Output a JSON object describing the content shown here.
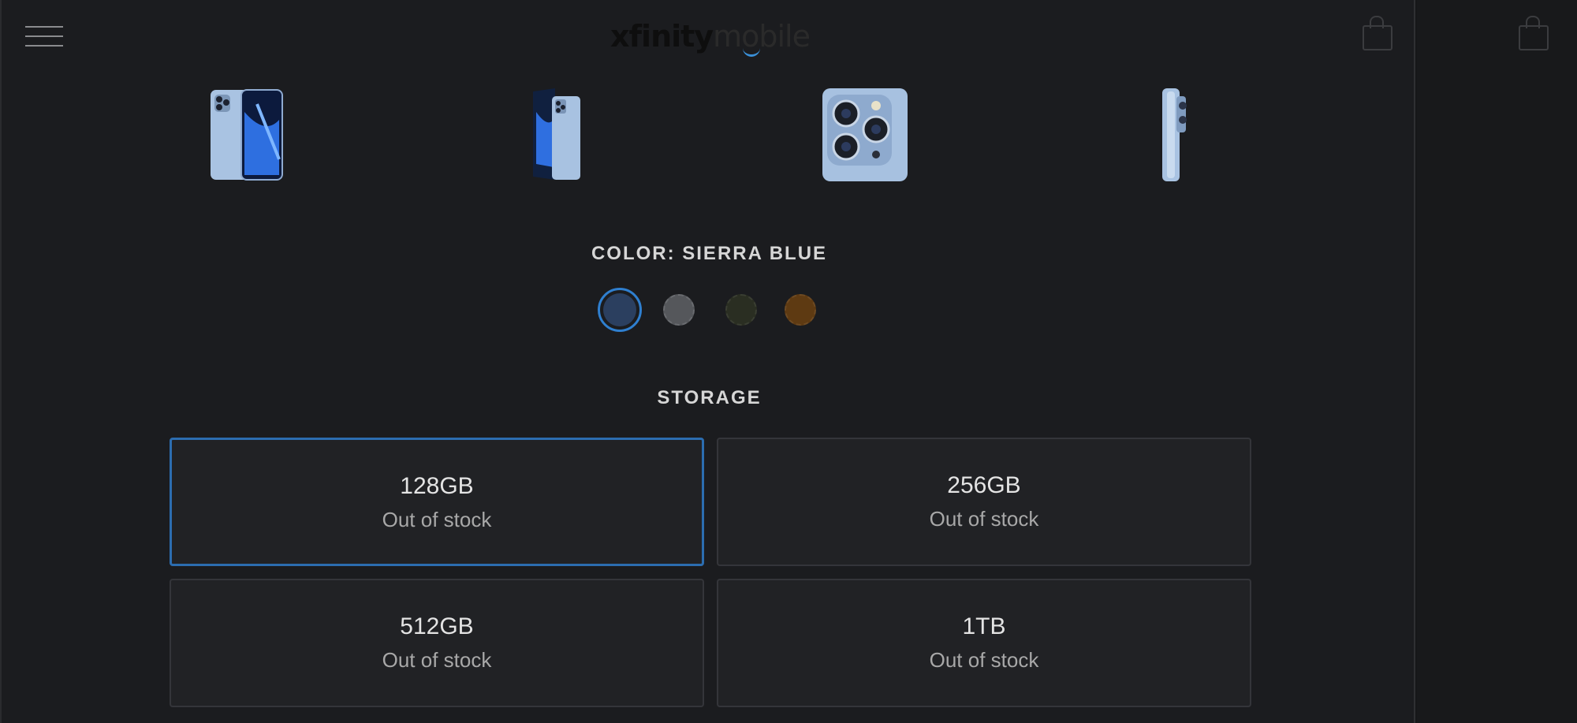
{
  "header": {
    "brand": "xfinity",
    "brand_sub": "mobile",
    "menu_icon": "hamburger-menu-icon",
    "cart_icon": "shopping-bag-icon"
  },
  "gallery": {
    "images": [
      {
        "name": "front-back-view",
        "icon": "phone-front-back-image"
      },
      {
        "name": "angled-view",
        "icon": "phone-angled-image"
      },
      {
        "name": "camera-closeup",
        "icon": "phone-camera-image"
      },
      {
        "name": "side-view",
        "icon": "phone-side-image"
      }
    ]
  },
  "color": {
    "label": "COLOR: SIERRA BLUE",
    "selected_index": 0,
    "swatches": [
      {
        "name": "sierra-blue",
        "hex": "#2b3f5f"
      },
      {
        "name": "graphite",
        "hex": "#55575b"
      },
      {
        "name": "alpine-green",
        "hex": "#2a2e22"
      },
      {
        "name": "gold",
        "hex": "#5e3a12"
      }
    ]
  },
  "storage": {
    "label": "STORAGE",
    "options": [
      {
        "size": "128GB",
        "status": "Out of stock",
        "selected": true
      },
      {
        "size": "256GB",
        "status": "Out of stock",
        "selected": false
      },
      {
        "size": "512GB",
        "status": "Out of stock",
        "selected": false
      },
      {
        "size": "1TB",
        "status": "Out of stock",
        "selected": false
      }
    ]
  },
  "colors": {
    "accent": "#2f7fcf",
    "page_bg": "#1b1c1f",
    "card_bg": "#212225"
  }
}
